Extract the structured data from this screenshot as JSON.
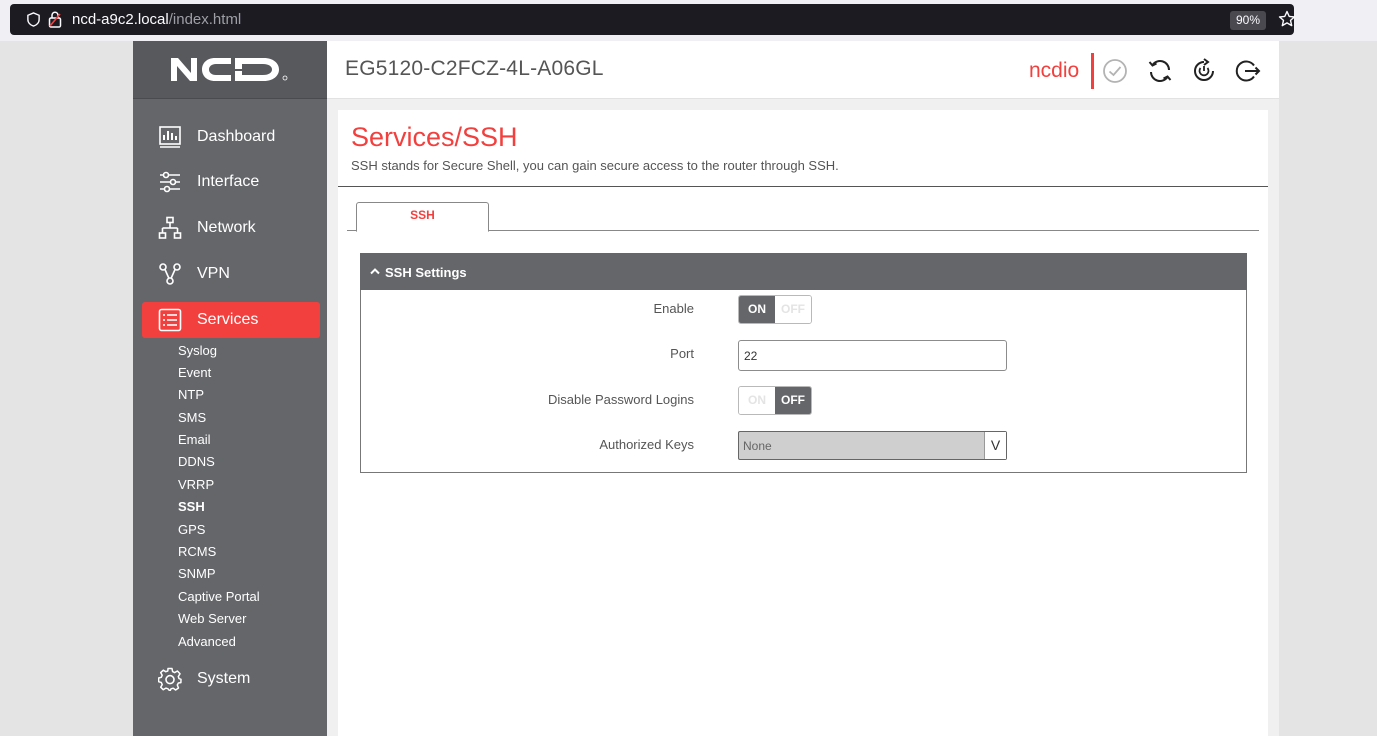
{
  "browser": {
    "url_host": "ncd-a9c2.local",
    "url_path": "/index.html",
    "zoom": "90%"
  },
  "brand": {
    "accent": "#f2403e",
    "sidebar_bg": "#646669",
    "logo_text": "NCD"
  },
  "header": {
    "device_name": "EG5120-C2FCZ-4L-A06GL",
    "user": "ncdio",
    "icons": [
      "check-circle-icon",
      "refresh-icon",
      "power-cycle-icon",
      "logout-icon"
    ]
  },
  "sidebar": {
    "items": [
      {
        "label": "Dashboard",
        "icon": "dashboard-icon"
      },
      {
        "label": "Interface",
        "icon": "sliders-icon"
      },
      {
        "label": "Network",
        "icon": "network-icon"
      },
      {
        "label": "VPN",
        "icon": "vpn-icon"
      },
      {
        "label": "Services",
        "icon": "list-icon",
        "active": true
      },
      {
        "label": "System",
        "icon": "gear-icon"
      }
    ],
    "services_subitems": [
      "Syslog",
      "Event",
      "NTP",
      "SMS",
      "Email",
      "DDNS",
      "VRRP",
      "SSH",
      "GPS",
      "RCMS",
      "SNMP",
      "Captive Portal",
      "Web Server",
      "Advanced"
    ],
    "active_subitem": "SSH"
  },
  "page": {
    "title": "Services/SSH",
    "description": "SSH stands for Secure Shell, you can gain secure access to the router through SSH."
  },
  "tabs": [
    {
      "label": "SSH",
      "active": true
    }
  ],
  "ssh_settings": {
    "section_title": "SSH Settings",
    "enable": {
      "label": "Enable",
      "on": "ON",
      "off": "OFF",
      "value": "ON"
    },
    "port": {
      "label": "Port",
      "value": "22"
    },
    "disable_password_logins": {
      "label": "Disable Password Logins",
      "on": "ON",
      "off": "OFF",
      "value": "OFF"
    },
    "authorized_keys": {
      "label": "Authorized Keys",
      "value": "None",
      "caret": "V"
    }
  }
}
